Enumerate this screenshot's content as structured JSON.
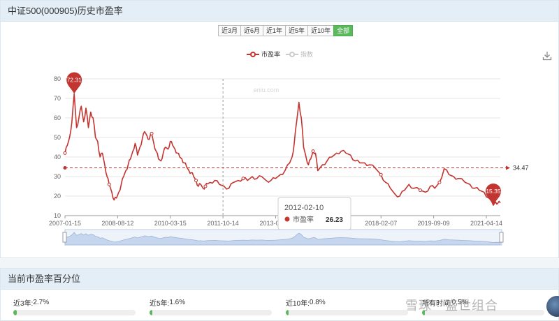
{
  "header": {
    "title": "中证500(000905)历史市盈率"
  },
  "range_tabs": [
    "近3月",
    "近6月",
    "近1年",
    "近5年",
    "近10年",
    "全部"
  ],
  "active_tab": "全部",
  "legend": [
    {
      "label": "市盈率",
      "color": "#c23531",
      "active": true
    },
    {
      "label": "指数",
      "color": "#cccccc",
      "active": false
    }
  ],
  "chart_data": {
    "type": "line",
    "series": [
      {
        "name": "市盈率",
        "color": "#c23531",
        "points": [
          [
            "2007-01-15",
            42
          ],
          [
            "2007-02-15",
            46
          ],
          [
            "2007-03-15",
            50
          ],
          [
            "2007-04-15",
            58
          ],
          [
            "2007-05-15",
            72.31
          ],
          [
            "2007-06-15",
            55
          ],
          [
            "2007-07-15",
            60
          ],
          [
            "2007-08-15",
            66
          ],
          [
            "2007-09-15",
            58
          ],
          [
            "2007-10-15",
            65
          ],
          [
            "2007-11-15",
            55
          ],
          [
            "2007-12-15",
            63
          ],
          [
            "2008-01-15",
            60
          ],
          [
            "2008-02-15",
            50
          ],
          [
            "2008-03-15",
            48
          ],
          [
            "2008-04-15",
            40
          ],
          [
            "2008-05-15",
            42
          ],
          [
            "2008-06-15",
            36
          ],
          [
            "2008-07-15",
            30
          ],
          [
            "2008-08-12",
            26
          ],
          [
            "2008-09-15",
            22
          ],
          [
            "2008-10-15",
            18
          ],
          [
            "2008-11-15",
            19
          ],
          [
            "2008-12-15",
            22
          ],
          [
            "2009-01-15",
            26
          ],
          [
            "2009-02-15",
            30
          ],
          [
            "2009-03-15",
            33
          ],
          [
            "2009-04-15",
            36
          ],
          [
            "2009-05-15",
            39
          ],
          [
            "2009-06-15",
            43
          ],
          [
            "2009-07-15",
            47
          ],
          [
            "2009-08-15",
            41
          ],
          [
            "2009-09-15",
            45
          ],
          [
            "2009-10-15",
            49
          ],
          [
            "2009-11-15",
            53
          ],
          [
            "2009-12-15",
            51
          ],
          [
            "2010-01-15",
            49
          ],
          [
            "2010-02-15",
            52
          ],
          [
            "2010-03-15",
            47
          ],
          [
            "2010-04-15",
            43
          ],
          [
            "2010-05-15",
            39
          ],
          [
            "2010-06-15",
            38
          ],
          [
            "2010-07-15",
            42
          ],
          [
            "2010-08-15",
            45
          ],
          [
            "2010-09-15",
            44
          ],
          [
            "2010-10-15",
            48
          ],
          [
            "2010-11-15",
            46
          ],
          [
            "2010-12-15",
            44
          ],
          [
            "2011-01-15",
            42
          ],
          [
            "2011-02-15",
            40
          ],
          [
            "2011-03-15",
            39
          ],
          [
            "2011-04-15",
            37
          ],
          [
            "2011-05-15",
            35
          ],
          [
            "2011-06-15",
            33
          ],
          [
            "2011-07-15",
            32
          ],
          [
            "2011-08-15",
            30
          ],
          [
            "2011-09-15",
            28
          ],
          [
            "2011-10-14",
            25
          ],
          [
            "2011-11-15",
            26
          ],
          [
            "2011-12-15",
            24
          ],
          [
            "2012-01-15",
            25
          ],
          [
            "2012-02-10",
            26.23
          ],
          [
            "2012-03-15",
            27
          ],
          [
            "2012-05-15",
            28
          ],
          [
            "2012-07-15",
            26
          ],
          [
            "2012-09-15",
            25
          ],
          [
            "2012-11-15",
            24
          ],
          [
            "2013-01-15",
            27
          ],
          [
            "2013-03-15",
            28
          ],
          [
            "2013-05-20",
            29
          ],
          [
            "2013-07-15",
            28
          ],
          [
            "2013-09-15",
            30
          ],
          [
            "2013-11-15",
            29
          ],
          [
            "2014-01-15",
            30
          ],
          [
            "2014-03-15",
            28
          ],
          [
            "2014-05-15",
            28
          ],
          [
            "2014-07-15",
            29
          ],
          [
            "2014-09-15",
            31
          ],
          [
            "2014-11-15",
            33
          ],
          [
            "2015-01-15",
            37
          ],
          [
            "2015-02-15",
            40
          ],
          [
            "2015-03-15",
            47
          ],
          [
            "2015-04-15",
            58
          ],
          [
            "2015-05-15",
            68
          ],
          [
            "2015-06-15",
            60
          ],
          [
            "2015-07-15",
            45
          ],
          [
            "2015-08-15",
            40
          ],
          [
            "2015-09-15",
            36
          ],
          [
            "2015-10-15",
            39
          ],
          [
            "2015-11-15",
            43
          ],
          [
            "2015-12-15",
            42
          ],
          [
            "2016-01-15",
            33
          ],
          [
            "2016-03-15",
            36
          ],
          [
            "2016-05-15",
            38
          ],
          [
            "2016-07-15",
            40
          ],
          [
            "2016-09-15",
            42
          ],
          [
            "2016-11-15",
            43
          ],
          [
            "2017-01-15",
            42
          ],
          [
            "2017-03-15",
            41
          ],
          [
            "2017-05-15",
            38
          ],
          [
            "2017-07-15",
            37
          ],
          [
            "2017-09-15",
            37
          ],
          [
            "2017-11-15",
            36
          ],
          [
            "2018-02-07",
            34
          ],
          [
            "2018-04-15",
            31
          ],
          [
            "2018-06-15",
            27
          ],
          [
            "2018-08-15",
            24
          ],
          [
            "2018-10-15",
            21
          ],
          [
            "2018-12-15",
            20
          ],
          [
            "2019-02-15",
            23
          ],
          [
            "2019-04-15",
            26
          ],
          [
            "2019-06-15",
            24
          ],
          [
            "2019-09-09",
            23
          ],
          [
            "2019-11-15",
            22
          ],
          [
            "2020-01-15",
            25
          ],
          [
            "2020-03-15",
            24
          ],
          [
            "2020-05-15",
            27
          ],
          [
            "2020-07-15",
            34
          ],
          [
            "2020-09-15",
            31
          ],
          [
            "2020-11-15",
            30
          ],
          [
            "2021-01-15",
            29
          ],
          [
            "2021-04-14",
            27
          ],
          [
            "2021-06-15",
            26
          ],
          [
            "2021-08-15",
            24
          ],
          [
            "2021-10-15",
            23
          ],
          [
            "2021-12-15",
            22
          ],
          [
            "2022-02-15",
            19
          ],
          [
            "2022-04-15",
            15.35
          ],
          [
            "2022-05-15",
            17
          ],
          [
            "2022-06-15",
            16.5
          ],
          [
            "2022-07-15",
            16.5
          ]
        ]
      }
    ],
    "x_tick_labels": [
      "2007-01-15",
      "2008-08-12",
      "2010-03-15",
      "2011-10-14",
      "2013-05-20",
      "2014-",
      "2018-02-07",
      "2019-09-09",
      "2021-04-14"
    ],
    "ylim": [
      10,
      80
    ],
    "y_ticks": [
      10,
      20,
      30,
      40,
      50,
      60,
      70,
      80
    ],
    "grid": true,
    "reference_line": {
      "value": 34.47,
      "label": "34.47",
      "color": "#c23531"
    },
    "max_marker": {
      "date": "2007-05-15",
      "label": "72.31"
    },
    "min_marker": {
      "date": "2022-04-15",
      "label": "15.35"
    },
    "crosshair_date": "2011-10-14",
    "watermark": "eniu.com",
    "tooltip": {
      "date": "2012-02-10",
      "series_label": "市盈率",
      "value": "26.23"
    }
  },
  "bottom_panel": {
    "title": "当前市盈率百分位",
    "items": [
      {
        "label": "近3年:",
        "value": "2.7%",
        "fraction": 0.027
      },
      {
        "label": "近5年:",
        "value": "1.6%",
        "fraction": 0.016
      },
      {
        "label": "近10年:",
        "value": "0.8%",
        "fraction": 0.008
      },
      {
        "label": "所有时间:",
        "value": "0.5%",
        "fraction": 0.005
      }
    ]
  },
  "watermark_text": "雪球 · 盛世组合"
}
